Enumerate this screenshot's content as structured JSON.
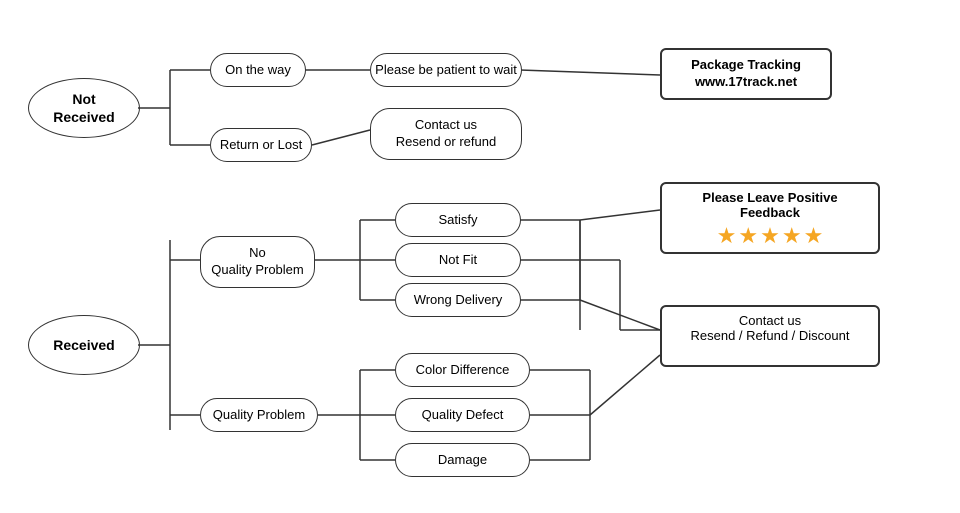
{
  "nodes": {
    "not_received": {
      "label": "Not\nReceived"
    },
    "on_the_way": {
      "label": "On the way"
    },
    "patient": {
      "label": "Please be patient to wait"
    },
    "package_tracking": {
      "label": "Package Tracking\nwww.17track.net"
    },
    "return_lost": {
      "label": "Return or Lost"
    },
    "contact_resend_refund": {
      "label": "Contact us\nResend or refund"
    },
    "received": {
      "label": "Received"
    },
    "no_quality_problem": {
      "label": "No\nQuality Problem"
    },
    "satisfy": {
      "label": "Satisfy"
    },
    "not_fit": {
      "label": "Not Fit"
    },
    "wrong_delivery": {
      "label": "Wrong Delivery"
    },
    "quality_problem": {
      "label": "Quality Problem"
    },
    "color_difference": {
      "label": "Color Difference"
    },
    "quality_defect": {
      "label": "Quality Defect"
    },
    "damage": {
      "label": "Damage"
    },
    "please_positive": {
      "label": "Please Leave Positive Feedback"
    },
    "contact_resend_refund_discount": {
      "label": "Contact us\nResend / Refund / Discount"
    },
    "stars": [
      "★",
      "★",
      "★",
      "★",
      "★"
    ]
  }
}
